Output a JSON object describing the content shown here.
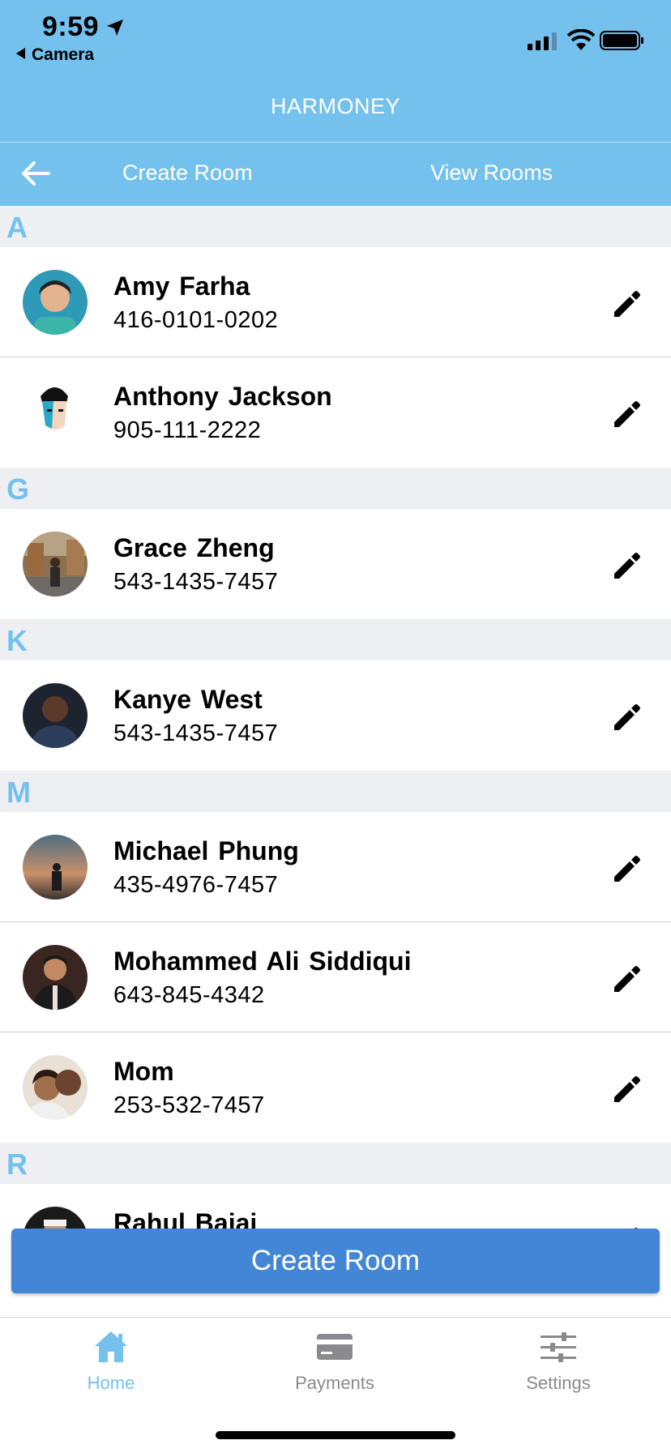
{
  "status_bar": {
    "time": "9:59",
    "back_app": "Camera"
  },
  "app": {
    "title": "HARMONEY"
  },
  "nav": {
    "create_label": "Create Room",
    "view_label": "View Rooms"
  },
  "sections": [
    {
      "letter": "A",
      "contacts": [
        {
          "name": "Amy Farha",
          "phone": "416-0101-0202",
          "avatar_bg": "#2f9ab8"
        },
        {
          "name": "Anthony Jackson",
          "phone": "905-111-2222",
          "avatar_bg": "#ffffff"
        }
      ]
    },
    {
      "letter": "G",
      "contacts": [
        {
          "name": "Grace Zheng",
          "phone": "543-1435-7457",
          "avatar_bg": "#8a7050"
        }
      ]
    },
    {
      "letter": "K",
      "contacts": [
        {
          "name": "Kanye West",
          "phone": "543-1435-7457",
          "avatar_bg": "#1d2430"
        }
      ]
    },
    {
      "letter": "M",
      "contacts": [
        {
          "name": "Michael Phung",
          "phone": "435-4976-7457",
          "avatar_bg": "#6b7d88"
        },
        {
          "name": "Mohammed Ali Siddiqui",
          "phone": "643-845-4342",
          "avatar_bg": "#3a2620"
        },
        {
          "name": "Mom",
          "phone": "253-532-7457",
          "avatar_bg": "#b07f58"
        }
      ]
    },
    {
      "letter": "R",
      "contacts": [
        {
          "name": "Rahul Bajaj",
          "phone": "",
          "avatar_bg": "#1a1a1a"
        }
      ]
    }
  ],
  "create_room_button": "Create Room",
  "tabs": [
    {
      "label": "Home",
      "icon": "home-icon",
      "active": true
    },
    {
      "label": "Payments",
      "icon": "credit-card-icon",
      "active": false
    },
    {
      "label": "Settings",
      "icon": "sliders-icon",
      "active": false
    }
  ],
  "colors": {
    "header": "#74c1ee",
    "accent": "#74c1ee",
    "button": "#4386d5",
    "section_bg": "#eeeff3"
  }
}
